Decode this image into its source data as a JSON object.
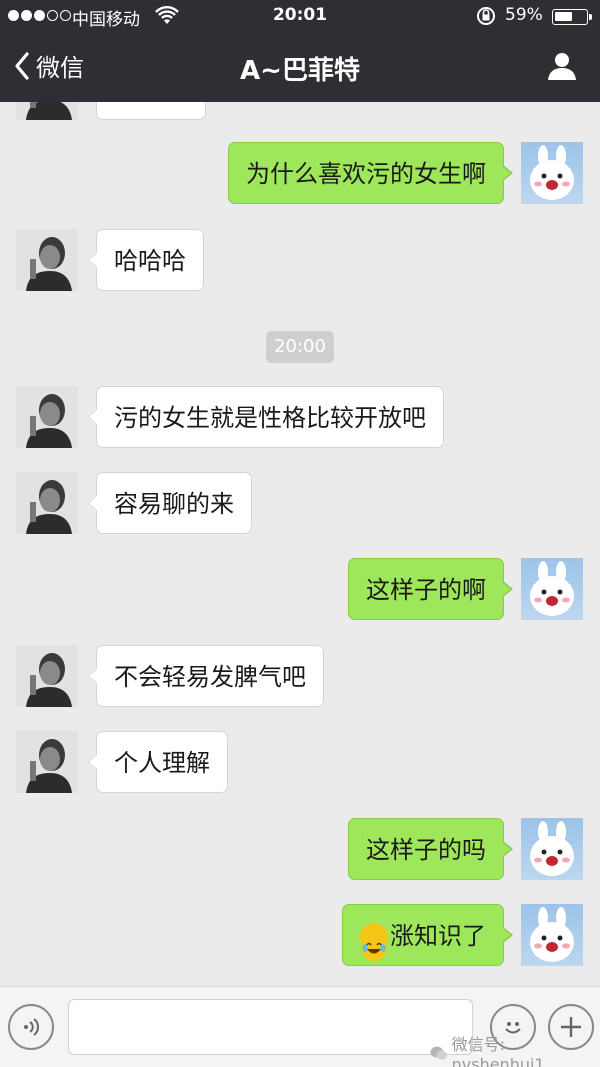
{
  "status_bar": {
    "carrier": "中国移动",
    "time": "20:01",
    "battery_percent": "59%",
    "battery_level": 0.59
  },
  "nav": {
    "back_label": "微信",
    "title": "A~巴菲特"
  },
  "messages": [
    {
      "sender": "other",
      "text": ""
    },
    {
      "sender": "me",
      "text": "为什么喜欢污的女生啊"
    },
    {
      "sender": "other",
      "text": "哈哈哈"
    },
    {
      "type": "timestamp",
      "text": "20:00"
    },
    {
      "sender": "other",
      "text": "污的女生就是性格比较开放吧"
    },
    {
      "sender": "other",
      "text": "容易聊的来"
    },
    {
      "sender": "me",
      "text": "这样子的啊"
    },
    {
      "sender": "other",
      "text": "不会轻易发脾气吧"
    },
    {
      "sender": "other",
      "text": "个人理解"
    },
    {
      "sender": "me",
      "text": "这样子的吗"
    },
    {
      "sender": "me",
      "text": "涨知识了",
      "emoji": "laugh-crying-emoji"
    }
  ],
  "input": {
    "value": "",
    "placeholder": ""
  },
  "watermark": "微信号: nvshenhui1",
  "colors": {
    "nav_bg": "#2f2f33",
    "chat_bg": "#ebebeb",
    "outgoing_bubble": "#9ee65a",
    "incoming_bubble": "#ffffff"
  },
  "icons": [
    "wifi-icon",
    "lock-rotation-icon",
    "back-chevron-icon",
    "profile-icon",
    "voice-icon",
    "smiley-icon",
    "plus-icon",
    "wechat-logo-icon"
  ]
}
